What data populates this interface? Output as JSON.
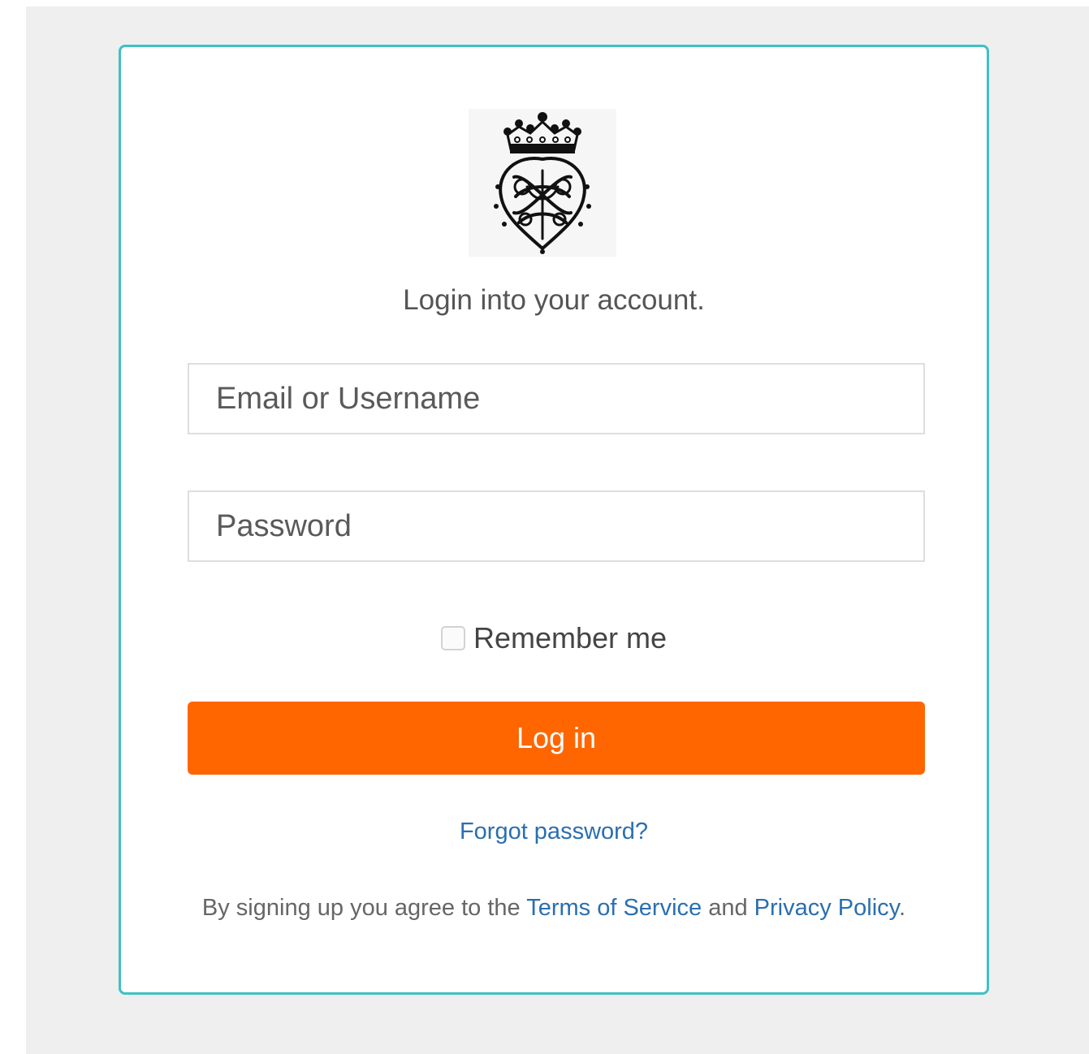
{
  "colors": {
    "page_background": "#efefef",
    "card_border": "#3fc1c2",
    "primary_button": "#ff6600",
    "link": "#2a6fb0",
    "text": "#555555"
  },
  "logo": {
    "icon": "crown-monogram-seal-logo"
  },
  "login": {
    "heading": "Login into your account.",
    "email_placeholder": "Email or Username",
    "email_value": "",
    "password_placeholder": "Password",
    "password_value": "",
    "remember_label": "Remember me",
    "remember_checked": false,
    "submit_label": "Log in",
    "forgot_label": "Forgot password?"
  },
  "legal": {
    "prefix": "By signing up you agree to the ",
    "terms_label": "Terms of Service",
    "middle": " and ",
    "privacy_label": "Privacy Policy",
    "suffix": "."
  }
}
